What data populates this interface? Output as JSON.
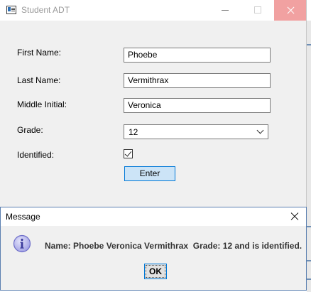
{
  "main_window": {
    "title": "Student ADT",
    "fields": {
      "first_name": {
        "label": "First Name:",
        "value": "Phoebe"
      },
      "last_name": {
        "label": "Last Name:",
        "value": "Vermithrax"
      },
      "middle_initial": {
        "label": "Middle Initial:",
        "value": "Veronica"
      },
      "grade": {
        "label": "Grade:",
        "selected": "12"
      },
      "identified": {
        "label": "Identified:",
        "checked": true
      }
    },
    "enter_label": "Enter",
    "icons": {
      "app": "app-window-icon",
      "minimize": "minimize-icon",
      "maximize": "maximize-icon",
      "close": "close-icon",
      "dropdown": "chevron-down-icon",
      "check": "checkmark-icon"
    },
    "colors": {
      "window_bg": "#f0f0f0",
      "close_hover": "#f1a1a1",
      "button_bg": "#cce4f7",
      "button_border": "#0078d7"
    }
  },
  "dialog": {
    "title": "Message",
    "message": "Name: Phoebe Veronica Vermithrax  Grade: 12 and is identified.",
    "ok_label": "OK",
    "icons": {
      "info": "information-icon",
      "close": "close-icon"
    },
    "colors": {
      "info_icon": "#6b6bc8",
      "border": "#5a7fb0"
    }
  }
}
